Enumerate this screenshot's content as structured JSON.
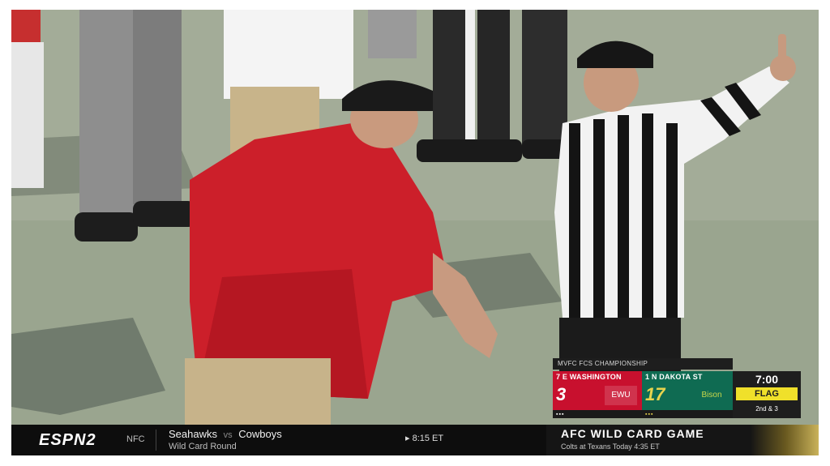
{
  "scorebug": {
    "title": "MVFC FCS CHAMPIONSHIP",
    "team_a": {
      "name": "7 E WASHINGTON",
      "score": "3",
      "logo": "EWU",
      "timeouts": "▪▪▪"
    },
    "team_b": {
      "name": "1 N DAKOTA ST",
      "score": "17",
      "logo": "Bison",
      "timeouts": "▪▪▪"
    },
    "clock": "7:00",
    "flag": "FLAG",
    "down": "2nd & 3"
  },
  "ticker": {
    "network": "ESPN2",
    "conference": "NFC",
    "team_left": "Seahawks",
    "vs": "vs",
    "team_right": "Cowboys",
    "round": "Wild Card Round",
    "start_time": "▸ 8:15 ET",
    "promo_headline": "AFC WILD CARD GAME",
    "promo_sub": "Colts at Texans Today 4:35 ET"
  },
  "colors": {
    "team_a": "#c8102e",
    "team_b": "#0f6b52",
    "flag": "#f0e02a"
  }
}
